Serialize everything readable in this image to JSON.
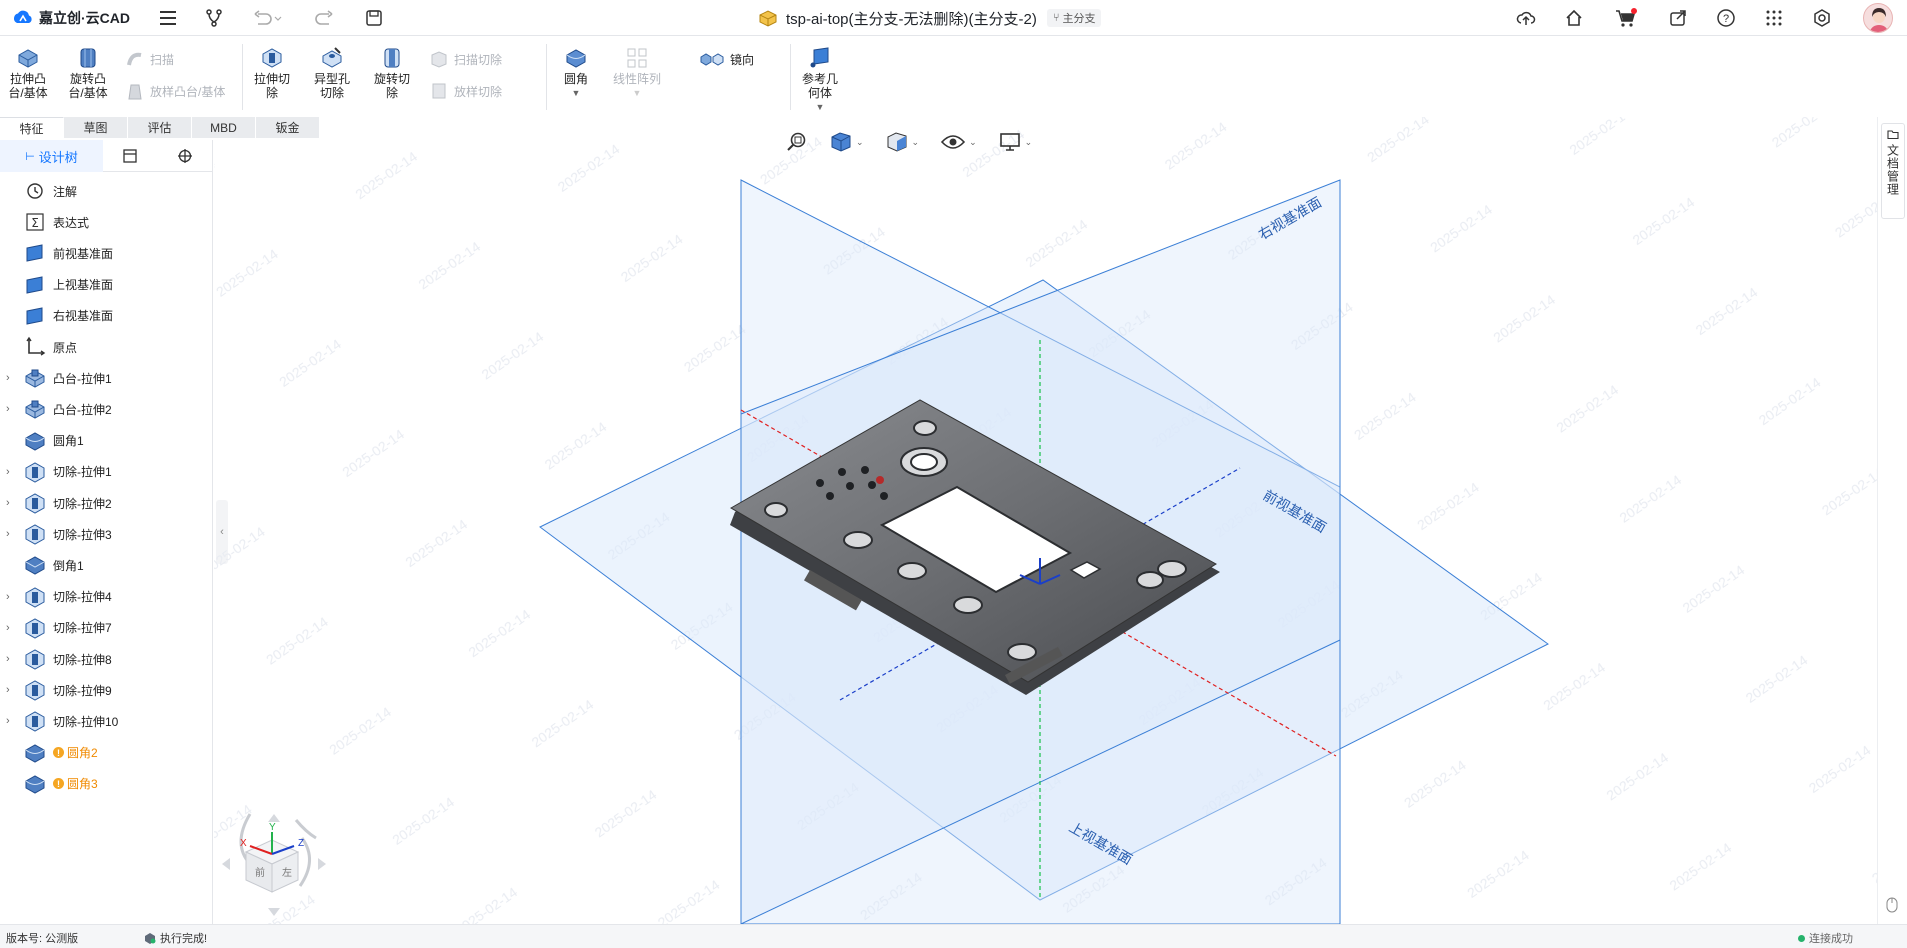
{
  "app": {
    "name": "嘉立创·云CAD"
  },
  "document": {
    "title": "tsp-ai-top(主分支-无法删除)(主分支-2)",
    "branch_tag": "主分支"
  },
  "ribbon": {
    "extrude_boss": "拉伸凸台/基体",
    "revolve_boss": "旋转凸台/基体",
    "sweep": "扫描",
    "loft_boss": "放样凸台/基体",
    "extrude_cut": "拉伸切除",
    "hole_wizard": "异型孔切除",
    "revolve_cut": "旋转切除",
    "sweep_cut": "扫描切除",
    "loft_cut": "放样切除",
    "fillet": "圆角",
    "linear_pattern": "线性阵列",
    "mirror": "镜向",
    "ref_geometry": "参考几何体"
  },
  "tabs": [
    "特征",
    "草图",
    "评估",
    "MBD",
    "钣金"
  ],
  "left_panel": {
    "tab_design_tree": "设计树",
    "tree": [
      {
        "label": "注解",
        "icon": "annotation-icon",
        "expandable": false,
        "warn": false
      },
      {
        "label": "表达式",
        "icon": "sigma-icon",
        "expandable": false,
        "warn": false
      },
      {
        "label": "前视基准面",
        "icon": "plane-icon",
        "expandable": false,
        "warn": false
      },
      {
        "label": "上视基准面",
        "icon": "plane-icon",
        "expandable": false,
        "warn": false
      },
      {
        "label": "右视基准面",
        "icon": "plane-icon",
        "expandable": false,
        "warn": false
      },
      {
        "label": "原点",
        "icon": "origin-icon",
        "expandable": false,
        "warn": false
      },
      {
        "label": "凸台-拉伸1",
        "icon": "boss-extrude-icon",
        "expandable": true,
        "warn": false
      },
      {
        "label": "凸台-拉伸2",
        "icon": "boss-extrude-icon",
        "expandable": true,
        "warn": false
      },
      {
        "label": "圆角1",
        "icon": "fillet-icon",
        "expandable": false,
        "warn": false
      },
      {
        "label": "切除-拉伸1",
        "icon": "cut-extrude-icon",
        "expandable": true,
        "warn": false
      },
      {
        "label": "切除-拉伸2",
        "icon": "cut-extrude-icon",
        "expandable": true,
        "warn": false
      },
      {
        "label": "切除-拉伸3",
        "icon": "cut-extrude-icon",
        "expandable": true,
        "warn": false
      },
      {
        "label": "倒角1",
        "icon": "chamfer-icon",
        "expandable": false,
        "warn": false
      },
      {
        "label": "切除-拉伸4",
        "icon": "cut-extrude-icon",
        "expandable": true,
        "warn": false
      },
      {
        "label": "切除-拉伸7",
        "icon": "cut-extrude-icon",
        "expandable": true,
        "warn": false
      },
      {
        "label": "切除-拉伸8",
        "icon": "cut-extrude-icon",
        "expandable": true,
        "warn": false
      },
      {
        "label": "切除-拉伸9",
        "icon": "cut-extrude-icon",
        "expandable": true,
        "warn": false
      },
      {
        "label": "切除-拉伸10",
        "icon": "cut-extrude-icon",
        "expandable": true,
        "warn": false
      },
      {
        "label": "圆角2",
        "icon": "fillet-icon",
        "expandable": false,
        "warn": true
      },
      {
        "label": "圆角3",
        "icon": "fillet-icon",
        "expandable": false,
        "warn": true
      }
    ]
  },
  "viewport": {
    "plane_labels": {
      "right": "右视基准面",
      "front": "前视基准面",
      "top": "上视基准面"
    },
    "triad": {
      "x": "X",
      "y": "Y",
      "z": "Z"
    },
    "cube_faces": {
      "front": "前",
      "left": "左"
    }
  },
  "right_strip": {
    "doc_mgmt": "文档管理"
  },
  "status": {
    "version": "版本号: 公测版",
    "message": "执行完成!",
    "connection": "连接成功"
  },
  "colors": {
    "accent": "#1677ff",
    "plane_fill": "#dbe9fb",
    "plane_edge": "#3b7fd6"
  }
}
